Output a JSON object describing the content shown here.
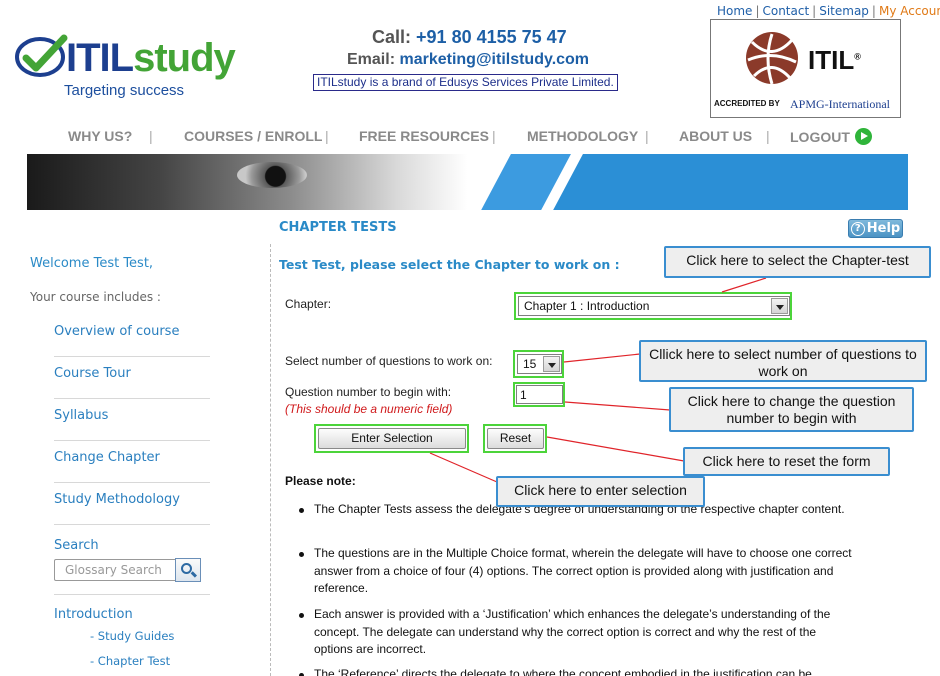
{
  "top_links": {
    "home": "Home",
    "contact": "Contact",
    "sitemap": "Sitemap",
    "account": "My Account",
    "separator": "|"
  },
  "logo": {
    "brand_i": "ITIL",
    "brand_s": "study",
    "tagline": "Targeting success"
  },
  "contact": {
    "call_label": "Call:",
    "call_value": "+91 80 4155 75 47",
    "email_label": "Email:",
    "email_value": "marketing@itilstudy.com",
    "brand_note": "ITILstudy is a brand of Edusys Services Private Limited."
  },
  "itil_badge": {
    "word": "ITIL",
    "registered": "®",
    "accredited": "ACCREDITED BY",
    "apmg": "APMG-International"
  },
  "nav": {
    "items": [
      "WHY US?",
      "COURSES / ENROLL",
      "FREE RESOURCES",
      "METHODOLOGY",
      "ABOUT US",
      "LOGOUT"
    ],
    "separator": "|"
  },
  "page": {
    "section_title": "CHAPTER TESTS",
    "help_label": "Help",
    "help_icon": "?"
  },
  "sidebar": {
    "welcome": "Welcome Test Test,",
    "includes": "Your course includes :",
    "links": [
      "Overview of course",
      "Course Tour",
      "Syllabus",
      "Change Chapter",
      "Study Methodology"
    ],
    "search_label": "Search",
    "search_placeholder": "Glossary Search",
    "section": "Introduction",
    "sub_links": [
      "- Study Guides",
      "- Chapter Test"
    ]
  },
  "form": {
    "heading": "Test Test, please select the Chapter to work on :",
    "chapter_label": "Chapter:",
    "chapter_value": "Chapter 1 : Introduction",
    "questions_label": "Select number of questions to work on:",
    "questions_value": "15",
    "begin_label": "Question number to begin with:",
    "begin_value": "1",
    "numeric_note": "(This should be a numeric field)",
    "enter_button": "Enter Selection",
    "reset_button": "Reset"
  },
  "callouts": {
    "chapter": "Click here to select the Chapter-test",
    "questions": "Cllick here to select number of questions to work on",
    "begin": "Click here to change the question number to begin with",
    "reset": "Click here to reset the form",
    "enter": "Click here to enter selection"
  },
  "notes": {
    "title": "Please note:",
    "items": [
      "The Chapter Tests assess the delegate’s degree of understanding of the respective chapter content.",
      "The questions are in the Multiple Choice format, wherein the delegate will have to choose one correct answer from a choice of four (4) options. The correct option is provided along with justification and reference.",
      "Each answer is provided with a ‘Justification’ which enhances the delegate’s understanding of the concept. The delegate can understand why the correct option is correct and why the rest of the options are incorrect.",
      "The ‘Reference’ directs the delegate to where the concept embodied in the justification can be"
    ]
  },
  "colors": {
    "brand_blue": "#1d3f8f",
    "brand_green": "#43a436",
    "link_blue": "#2a7fbf",
    "highlight_green": "#4cd43a",
    "callout_border": "#3a8ed0",
    "connector_red": "#e0242a",
    "warning_red": "#d0191b"
  }
}
